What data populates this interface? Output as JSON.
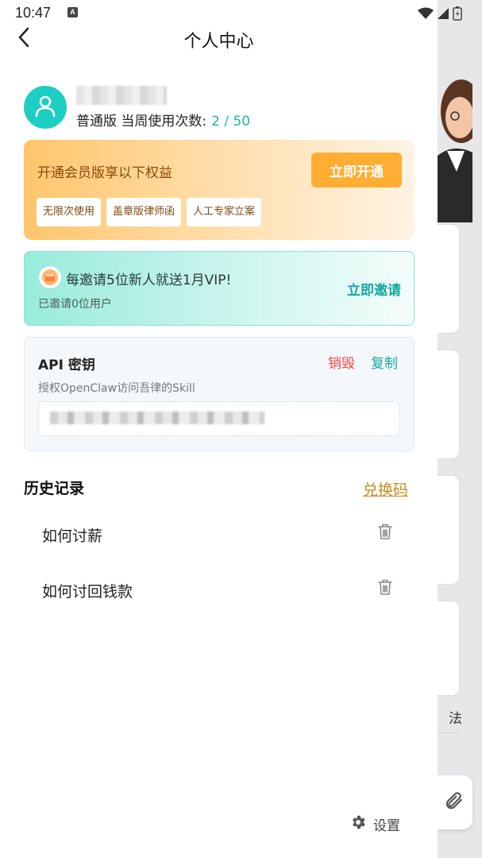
{
  "status_bar": {
    "time": "10:47",
    "badge": "A"
  },
  "header": {
    "title": "个人中心",
    "back_icon": "chevron-left-icon"
  },
  "profile": {
    "plan": "普通版 当周使用次数:",
    "usage": "2 / 50"
  },
  "vip": {
    "title": "开通会员版享以下权益",
    "button": "立即开通",
    "tags": [
      "无限次使用",
      "盖章版律师函",
      "人工专家立案"
    ]
  },
  "invite": {
    "title": "每邀请5位新人就送1月VIP!",
    "subtitle": "已邀请0位用户",
    "button": "立即邀请"
  },
  "api": {
    "title": "API 密钥",
    "destroy": "销毁",
    "copy": "复制",
    "description": "授权OpenClaw访问吾律的Skill"
  },
  "history": {
    "title": "历史记录",
    "redeem": "兑换码",
    "items": [
      {
        "text": "如何讨薪"
      },
      {
        "text": "如何讨回钱款"
      }
    ]
  },
  "footer": {
    "settings": "设置"
  },
  "background_app": {
    "partial_text": "法"
  },
  "colors": {
    "teal": "#1ccfc2",
    "orange": "#ffad33",
    "red": "#ef4b4b",
    "gold": "#c98a1a"
  }
}
